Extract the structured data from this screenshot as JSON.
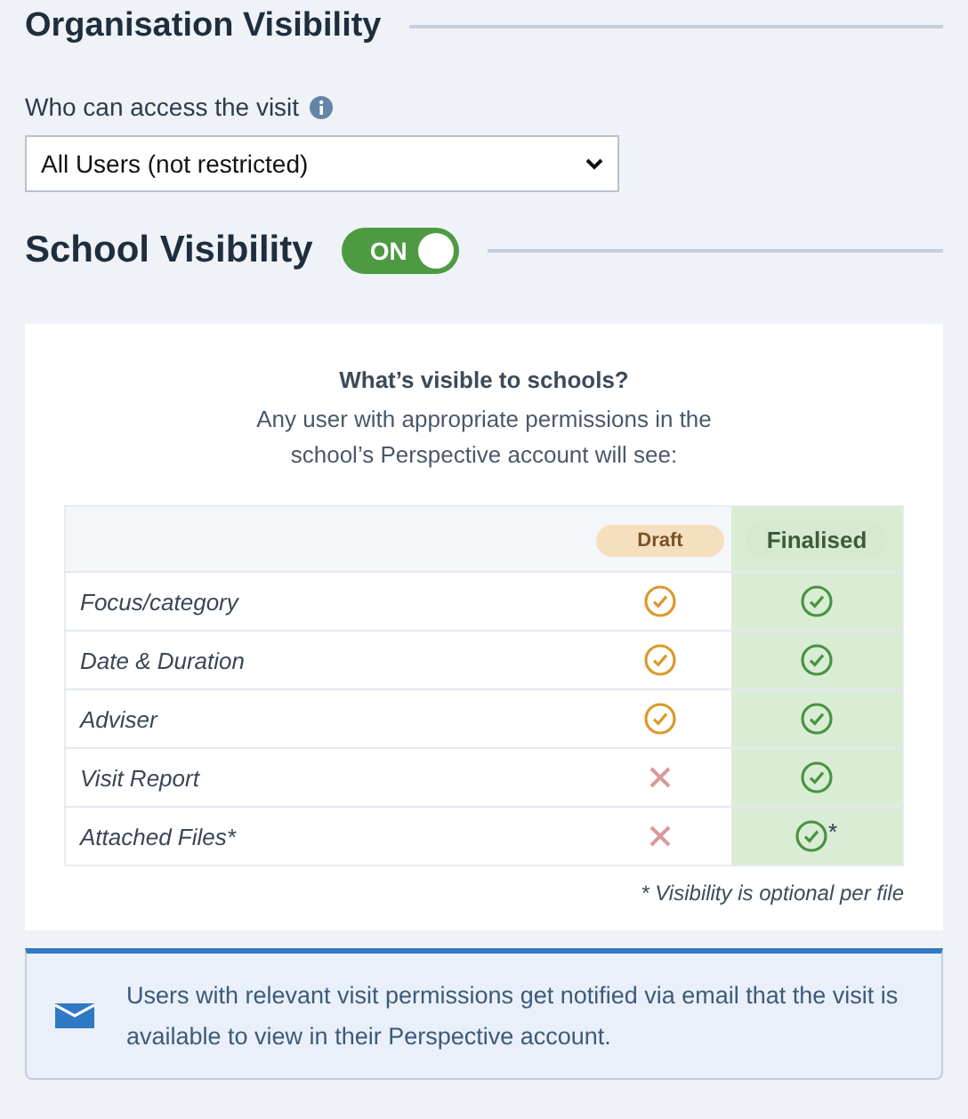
{
  "organisation_visibility": {
    "title": "Organisation Visibility",
    "access_label": "Who can access the visit",
    "access_value": "All Users (not restricted)"
  },
  "school_visibility": {
    "title": "School Visibility",
    "toggle": {
      "label": "ON",
      "on": true
    }
  },
  "visibility_card": {
    "title": "What’s visible to schools?",
    "subtitle": "Any user with appropriate permissions in the school’s Perspective account will see:",
    "columns": [
      "Draft",
      "Finalised"
    ],
    "rows": [
      {
        "label": "Focus/category",
        "draft": true,
        "finalised": true
      },
      {
        "label": "Date & Duration",
        "draft": true,
        "finalised": true
      },
      {
        "label": "Adviser",
        "draft": true,
        "finalised": true
      },
      {
        "label": "Visit Report",
        "draft": false,
        "finalised": true
      },
      {
        "label": "Attached Files*",
        "draft": false,
        "finalised": true,
        "finalised_note": "*"
      }
    ],
    "footnote": "* Visibility is optional per file"
  },
  "notice": {
    "text": "Users with relevant visit permissions get notified via email that the visit is available to view in their Perspective account."
  }
}
